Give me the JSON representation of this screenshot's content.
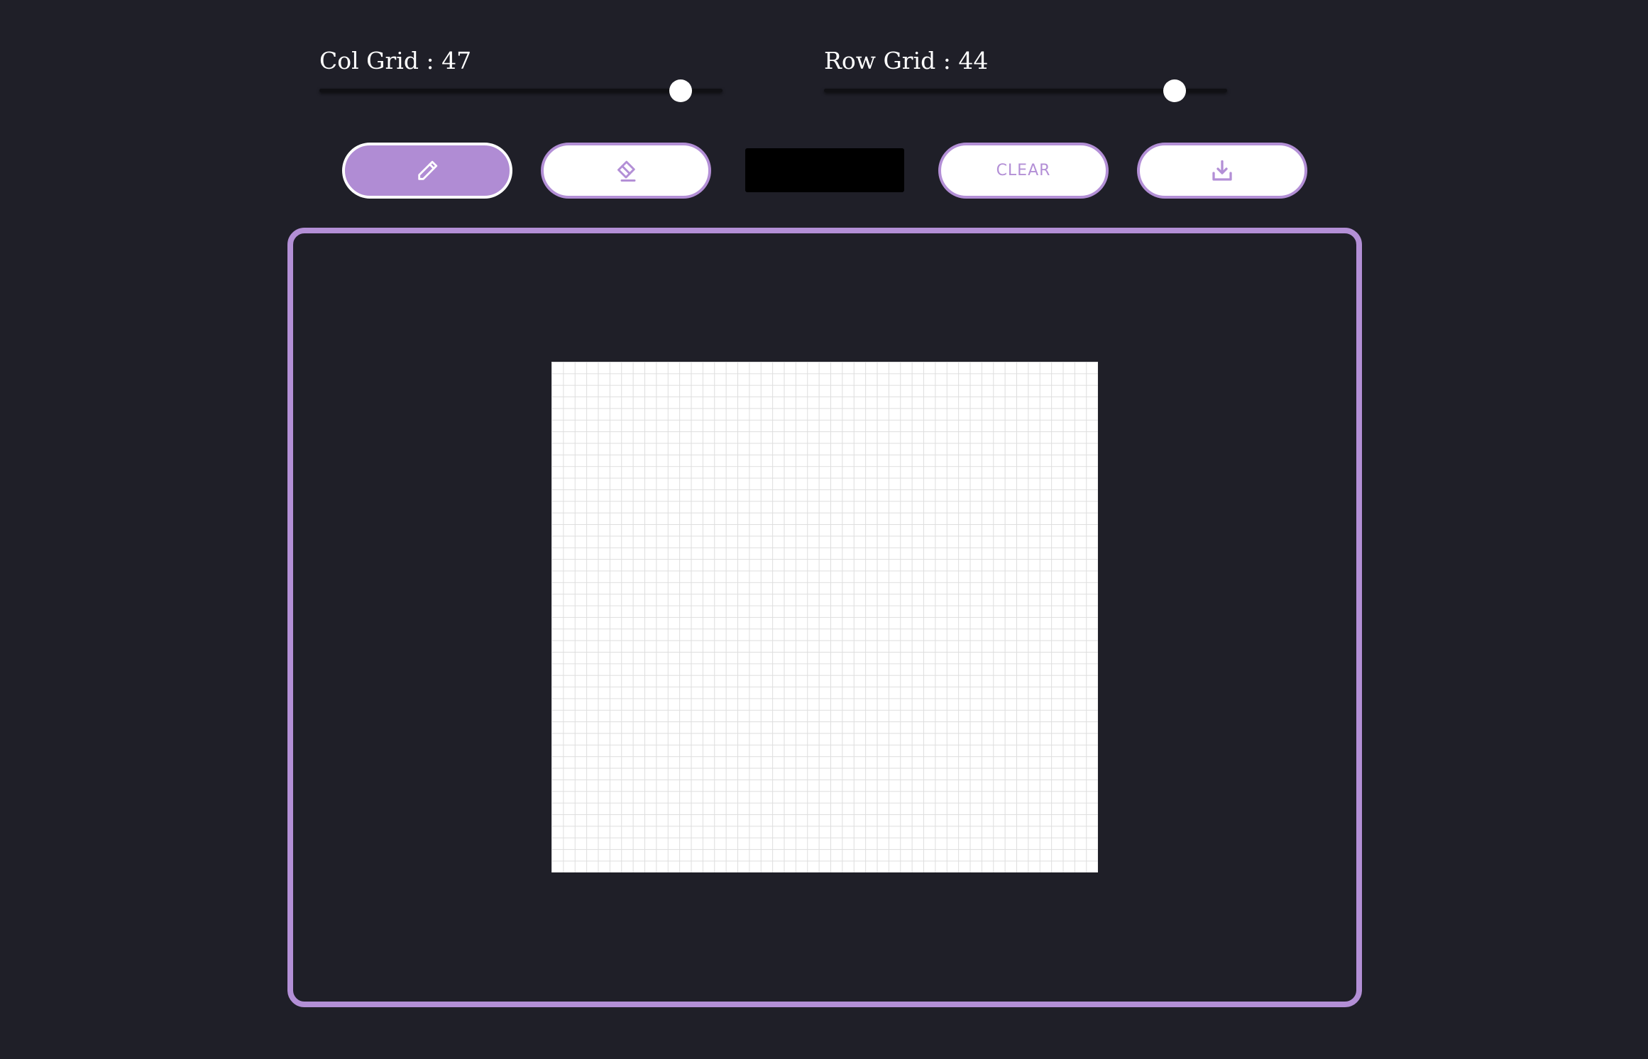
{
  "controls": {
    "col_grid": {
      "label_prefix": "Col Grid : ",
      "value": 47,
      "min": 4,
      "max": 52
    },
    "row_grid": {
      "label_prefix": "Row Grid : ",
      "value": 44,
      "min": 4,
      "max": 50
    }
  },
  "toolbar": {
    "pencil_icon": "pencil-icon",
    "eraser_icon": "eraser-icon",
    "clear_label": "CLEAR",
    "download_icon": "download-icon",
    "active_tool": "pencil",
    "selected_color": "#000000"
  },
  "canvas": {
    "columns": 47,
    "rows": 44
  },
  "colors": {
    "background": "#1f1f28",
    "accent": "#b38fd6",
    "grid_line": "#dedede",
    "grid_background": "#ffffff"
  }
}
